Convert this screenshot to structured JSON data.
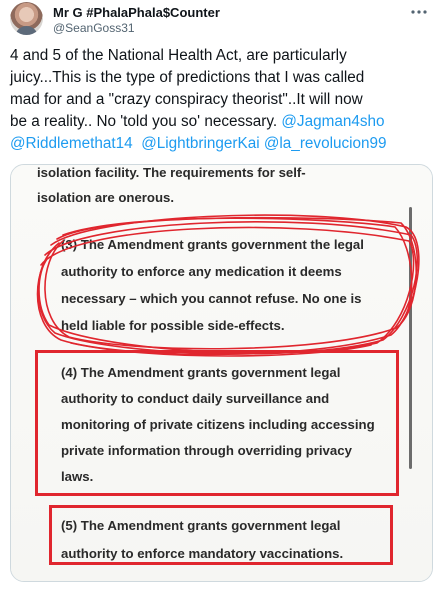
{
  "author": {
    "name": "Mr G #PhalaPhala$Counter",
    "handle": "@SeanGoss31"
  },
  "tweet": {
    "line1": "4 and 5 of the National Health Act, are particularly",
    "line2": "juicy...This is the type of predictions that I was called",
    "line3": "mad for and a \"crazy conspiracy theorist\"..It will now",
    "line4_text": "be a reality.. No 'told you so' necessary. ",
    "mentions": [
      "@Jagman4sho",
      "@Riddlemethat14",
      "@LightbringerKai",
      "@la_revolucion99"
    ]
  },
  "document": {
    "lines": [
      "isolation facility. The requirements for self-",
      "isolation are onerous.",
      "(3) The Amendment grants government the legal",
      "authority to enforce any medication it deems",
      "necessary – which you cannot refuse. No one is",
      "held liable for possible side-effects.",
      "(4) The Amendment grants government legal",
      "authority to conduct daily surveillance and",
      "monitoring of private citizens including accessing",
      "private information through overriding privacy",
      "laws.",
      "(5) The Amendment grants government legal",
      "authority to enforce mandatory vaccinations."
    ]
  },
  "colors": {
    "link": "#1d9bf0",
    "annotation_red": "#e0262e",
    "handle_gray": "#536471"
  },
  "icons": {
    "more": "more-options-icon",
    "avatar": "avatar"
  }
}
